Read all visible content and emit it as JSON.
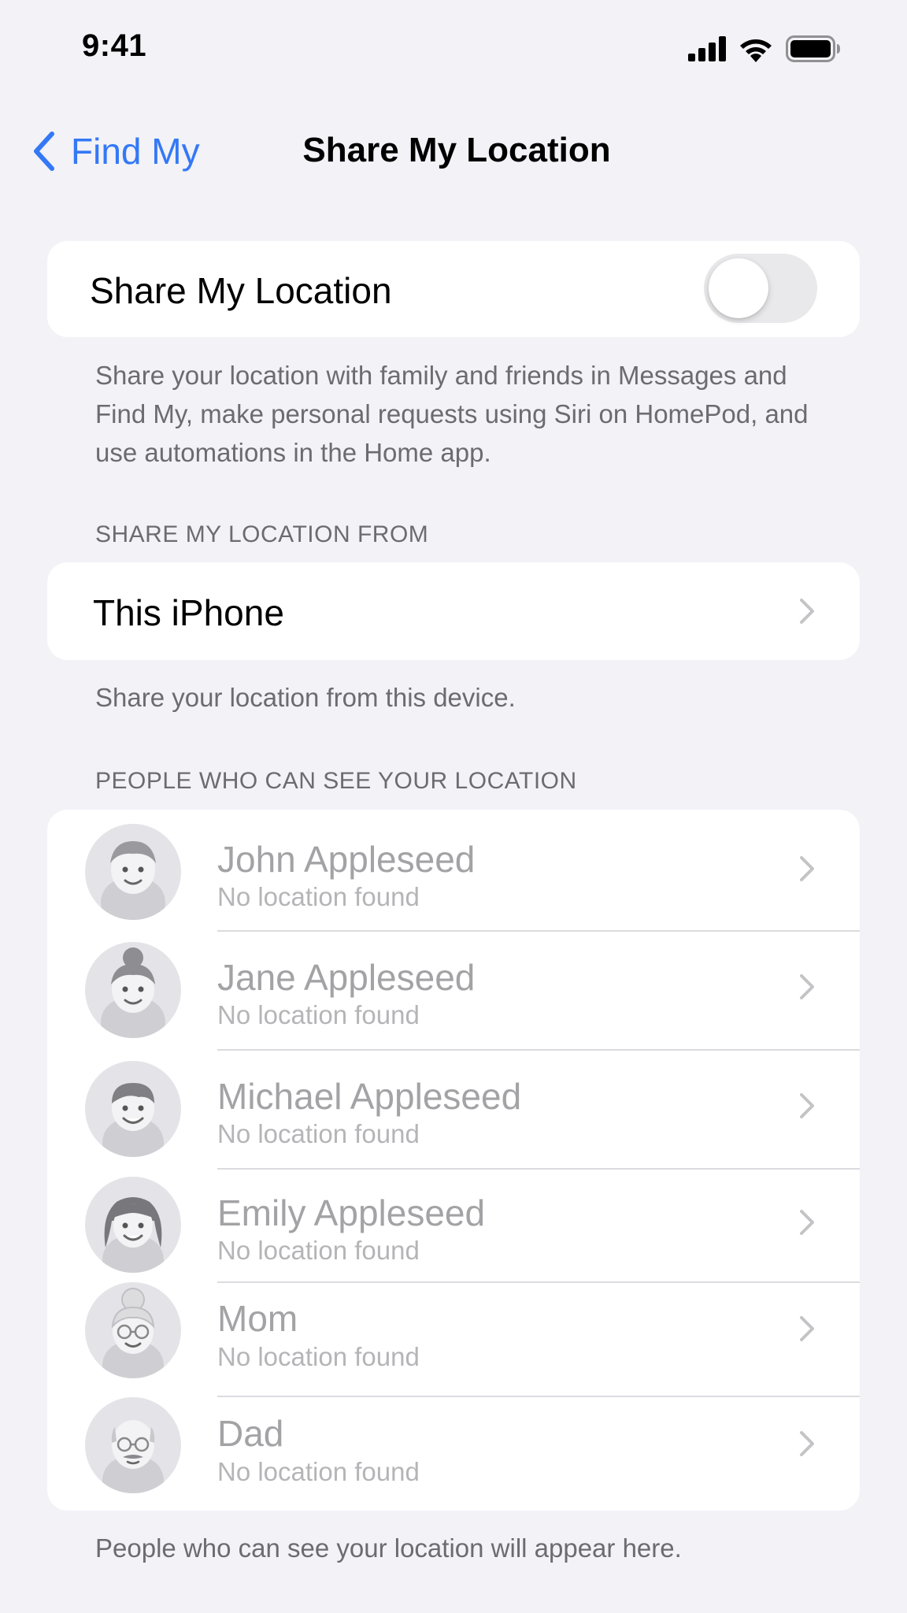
{
  "status_bar": {
    "time": "9:41",
    "icons": [
      "cellular-signal-icon",
      "wifi-icon",
      "battery-icon"
    ]
  },
  "nav": {
    "back_label": "Find My",
    "title": "Share My Location"
  },
  "share_toggle": {
    "label": "Share My Location",
    "enabled": false
  },
  "share_description": "Share your location with family and friends in Messages and Find My, make personal requests using Siri on HomePod, and use automations in the Home app.",
  "from_section": {
    "header": "SHARE MY LOCATION FROM",
    "device": "This iPhone",
    "footer": "Share your location from this device."
  },
  "people_section": {
    "header": "PEOPLE WHO CAN SEE YOUR LOCATION",
    "people": [
      {
        "name": "John Appleseed",
        "status": "No location found",
        "avatar": "memoji-man-icon"
      },
      {
        "name": "Jane Appleseed",
        "status": "No location found",
        "avatar": "memoji-woman-bun-icon"
      },
      {
        "name": "Michael Appleseed",
        "status": "No location found",
        "avatar": "memoji-boy-icon"
      },
      {
        "name": "Emily Appleseed",
        "status": "No location found",
        "avatar": "memoji-girl-icon"
      },
      {
        "name": "Mom",
        "status": "No location found",
        "avatar": "memoji-grandma-icon"
      },
      {
        "name": "Dad",
        "status": "No location found",
        "avatar": "memoji-grandpa-icon"
      }
    ],
    "footer": "People who can see your location will appear here."
  },
  "colors": {
    "background": "#f2f2f7",
    "card": "#ffffff",
    "accent": "#3478f6",
    "secondary_text": "#6c6c70",
    "disabled_text": "#a3a3a6"
  }
}
